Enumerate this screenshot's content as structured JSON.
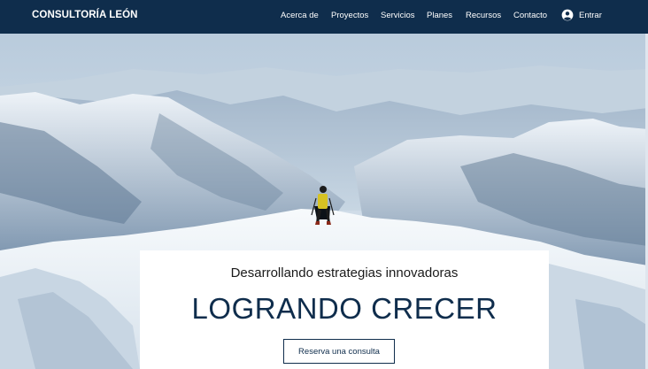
{
  "header": {
    "brand": "CONSULTORÍA LEÓN",
    "nav": [
      "Acerca de",
      "Proyectos",
      "Servicios",
      "Planes",
      "Recursos",
      "Contacto"
    ],
    "login_label": "Entrar",
    "login_icon": "user-circle-icon"
  },
  "hero": {
    "image": "mountain-climber-summit",
    "subtitle": "Desarrollando estrategias innovadoras",
    "title": "LOGRANDO CRECER",
    "cta_label": "Reserva una consulta"
  },
  "colors": {
    "navy": "#0f2d4c",
    "white": "#ffffff",
    "sky": "#cfdce7",
    "snow": "#eef3f8",
    "shadow": "#6f8aa6"
  }
}
